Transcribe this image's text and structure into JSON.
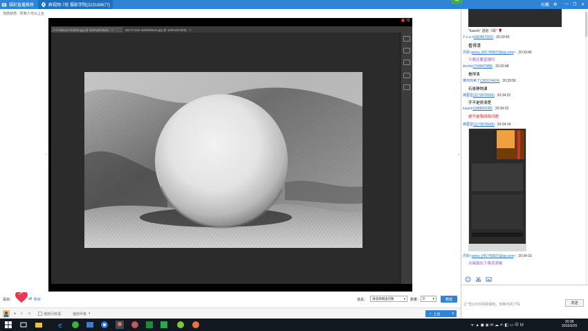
{
  "window": {
    "tab1_label": "福彩直播推荐",
    "tab2_label": "群视频-7班 摄影学院(323189677)",
    "badge": "44",
    "right_buttons": [
      "社教",
      "设置"
    ]
  },
  "notice": "当前状态：所有人可以上台",
  "video": {
    "rec_label": "72",
    "ps_tab1": "7-7A9814A724029.jpg @ 100%(RGB/8)",
    "ps_tab2": "69A7C15C-9450086A9.jpg @ 100%(RGB/8)"
  },
  "like": {
    "label": "喜欢：",
    "count": "x0",
    "more": "购买"
  },
  "gift": {
    "label": "道具：",
    "selected": "请选择赠送对象",
    "qty_label": "数量：",
    "qty": "9",
    "give_button": "赠送"
  },
  "toolbar": {
    "item1": "播放问候语",
    "item2": "播放伴奏",
    "mic_button": "上台"
  },
  "chat": {
    "messages": [
      {
        "name": "\"kaavie\" 送给 \"J哥\"",
        "link": "",
        "time": "",
        "text": ""
      },
      {
        "name": "Y u a n",
        "link": "(383807320)",
        "time": "20:33:43",
        "text": "看得清",
        "color": "#000000"
      },
      {
        "name": "丹影<",
        "link": "anna_641745837@qq.com",
        "time": "20:33:46",
        "text": "今晚还要直播吗",
        "color": "#9b59d0"
      },
      {
        "name": "Archer",
        "link": "(704847988)",
        "time": "20:33:48",
        "text": "看得清",
        "color": "#000000"
      },
      {
        "name": "黄鸡鸡卖了",
        "link": "(181674474)",
        "time": "20:33:56",
        "text": "石膏静物课",
        "color": "#000000"
      },
      {
        "name": "烤蓉型",
        "link": "(1173878536)",
        "time": "20:34:01",
        "text": "字不是很清楚",
        "color": "#000000"
      },
      {
        "name": "kaavie",
        "link": "(398806298)",
        "time": "20:34:02",
        "text": "是不是我网络问题",
        "color": "#e02020"
      },
      {
        "name": "烤蓉型",
        "link": "(1173878536)",
        "time": "20:34:14",
        "text": "",
        "color": "#000000"
      },
      {
        "name": "丹影<",
        "link": "anna_641745837@qq.com",
        "time": "20:34:16",
        "text": "点画面右下角变清晰",
        "color": "#9b59d0"
      }
    ],
    "input_placeholder": "[广告]1元手机购保险，你换手机了吗",
    "send_button": "发送"
  },
  "clock": {
    "time": "20:38",
    "date": "2016/3/25"
  },
  "colors": {
    "titlebar": "#2f84d6",
    "taskbar": "#101820",
    "link": "#2e6fc7"
  }
}
